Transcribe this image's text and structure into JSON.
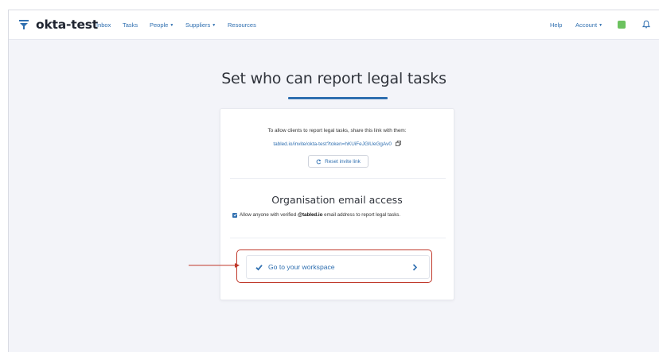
{
  "navbar": {
    "brand": "okta-test",
    "links": {
      "inbox": "Inbox",
      "tasks": "Tasks",
      "people": "People",
      "suppliers": "Suppliers",
      "resources": "Resources",
      "help": "Help",
      "account": "Account"
    },
    "status_color": "#6cc25f",
    "icons": [
      "funnel-logo-icon",
      "caret-down-icon",
      "bell-icon"
    ]
  },
  "page": {
    "title": "Set who can report legal tasks"
  },
  "invite": {
    "share_text": "To allow clients to report legal tasks, share this link with them:",
    "link": "tabled.io/invite/okta-test?token=hKUiFeJGlUeGgAv0",
    "reset_label": "Reset invite link"
  },
  "org_access": {
    "title": "Organisation email access",
    "checked": true,
    "text_before": "Allow anyone with verified",
    "domain": "@tabled.io",
    "text_after": "email address to report legal tasks."
  },
  "workspace": {
    "button_label": "Go to your workspace"
  },
  "colors": {
    "accent": "#2f6fb0",
    "highlight": "#c0392b",
    "background": "#f3f4f9"
  }
}
